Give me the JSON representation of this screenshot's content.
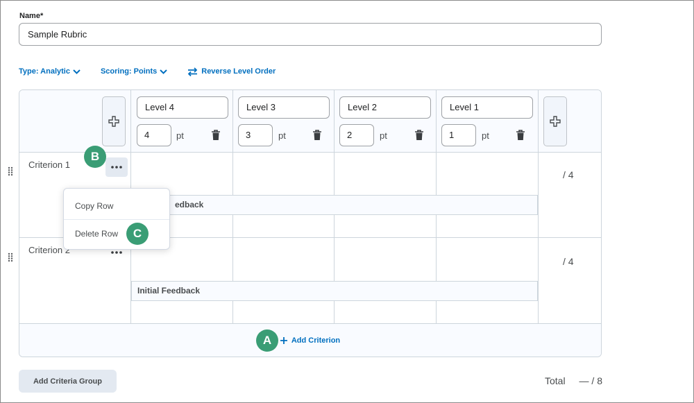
{
  "form": {
    "name_label": "Name*",
    "name_value": "Sample Rubric"
  },
  "toolbar": {
    "type_label": "Type: Analytic",
    "scoring_label": "Scoring: Points",
    "reverse_label": "Reverse Level Order",
    "link_color": "#006fbf"
  },
  "levels": [
    {
      "name": "Level 4",
      "points": "4",
      "unit": "pt"
    },
    {
      "name": "Level 3",
      "points": "3",
      "unit": "pt"
    },
    {
      "name": "Level 2",
      "points": "2",
      "unit": "pt"
    },
    {
      "name": "Level 1",
      "points": "1",
      "unit": "pt"
    }
  ],
  "criteria": [
    {
      "name": "Criterion 1",
      "score": "/ 4",
      "feedback_label": "Initial Feedback"
    },
    {
      "name": "Criterion 2",
      "score": "/ 4",
      "feedback_label": "Initial Feedback"
    }
  ],
  "feedback_visible": "edback",
  "context_menu": {
    "items": [
      "Copy Row",
      "Delete Row"
    ]
  },
  "add_criterion_label": "Add Criterion",
  "add_group_label": "Add Criteria Group",
  "total": {
    "label": "Total",
    "value": "— / 8"
  },
  "badges": {
    "a": "A",
    "b": "B",
    "c": "C",
    "color": "#3a9d75"
  },
  "icons": {
    "chevron": "chevron-down-icon",
    "swap": "swap-arrows-icon",
    "plus": "plus-icon",
    "trash": "trash-icon",
    "more": "ellipsis-icon",
    "drag": "drag-handle-icon"
  }
}
